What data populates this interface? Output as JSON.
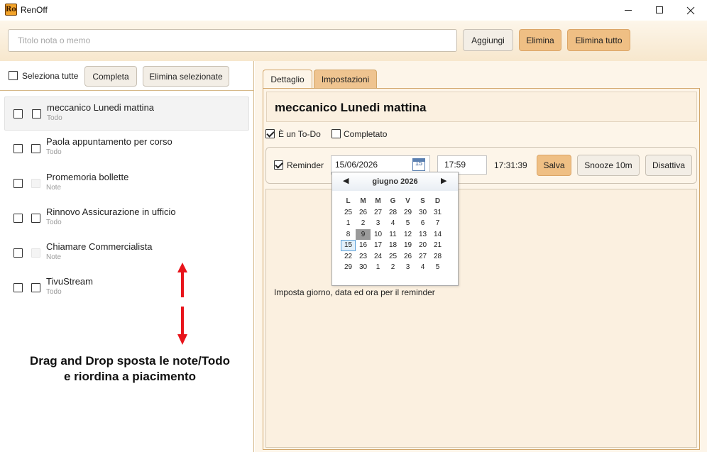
{
  "window": {
    "title": "RenOff",
    "logo_text": "Ro"
  },
  "topbar": {
    "input_placeholder": "Titolo nota o memo",
    "add_label": "Aggiungi",
    "delete_label": "Elimina",
    "delete_all_label": "Elimina tutto"
  },
  "list_toolbar": {
    "select_all_label": "Seleziona tutte",
    "complete_label": "Completa",
    "delete_selected_label": "Elimina selezionate"
  },
  "items": [
    {
      "title": "meccanico Lunedi mattina",
      "kind": "Todo",
      "selected": true
    },
    {
      "title": "Paola appuntamento per corso",
      "kind": "Todo"
    },
    {
      "title": "Promemoria bollette",
      "kind": "Note"
    },
    {
      "title": "Rinnovo Assicurazione in ufficio",
      "kind": "Todo"
    },
    {
      "title": "Chiamare Commercialista",
      "kind": "Note"
    },
    {
      "title": "TivuStream",
      "kind": "Todo"
    }
  ],
  "annotation": {
    "line1": "Drag and Drop sposta le note/Todo",
    "line2": "e riordina a piacimento"
  },
  "tabs": [
    {
      "label": "Dettaglio",
      "active": true
    },
    {
      "label": "Impostazioni",
      "active": false
    }
  ],
  "detail": {
    "title": "meccanico Lunedi mattina",
    "is_todo_label": "È un To-Do",
    "is_todo_checked": true,
    "completed_label": "Completato",
    "completed_checked": false,
    "reminder_label": "Reminder",
    "reminder_checked": true,
    "date_value": "15/06/2026",
    "calendar_icon_text": "15",
    "time_value": "17:59",
    "current_time": "17:31:39",
    "save_label": "Salva",
    "snooze_label": "Snooze 10m",
    "disable_label": "Disattiva",
    "hint": "Imposta giorno, data ed ora per il reminder"
  },
  "calendar": {
    "month_label": "giugno 2026",
    "prev_icon": "◀",
    "next_icon": "▶",
    "weekdays": [
      "L",
      "M",
      "M",
      "G",
      "V",
      "S",
      "D"
    ],
    "weeks": [
      [
        "25",
        "26",
        "27",
        "28",
        "29",
        "30",
        "31"
      ],
      [
        "1",
        "2",
        "3",
        "4",
        "5",
        "6",
        "7"
      ],
      [
        "8",
        "9",
        "10",
        "11",
        "12",
        "13",
        "14"
      ],
      [
        "15",
        "16",
        "17",
        "18",
        "19",
        "20",
        "21"
      ],
      [
        "22",
        "23",
        "24",
        "25",
        "26",
        "27",
        "28"
      ],
      [
        "29",
        "30",
        "1",
        "2",
        "3",
        "4",
        "5"
      ]
    ],
    "today": "9",
    "selected": "15"
  },
  "colors": {
    "accent": "#efbf84",
    "panel": "#fdf5e9",
    "border_accent": "#d2a66a",
    "arrow": "#e8141b"
  }
}
